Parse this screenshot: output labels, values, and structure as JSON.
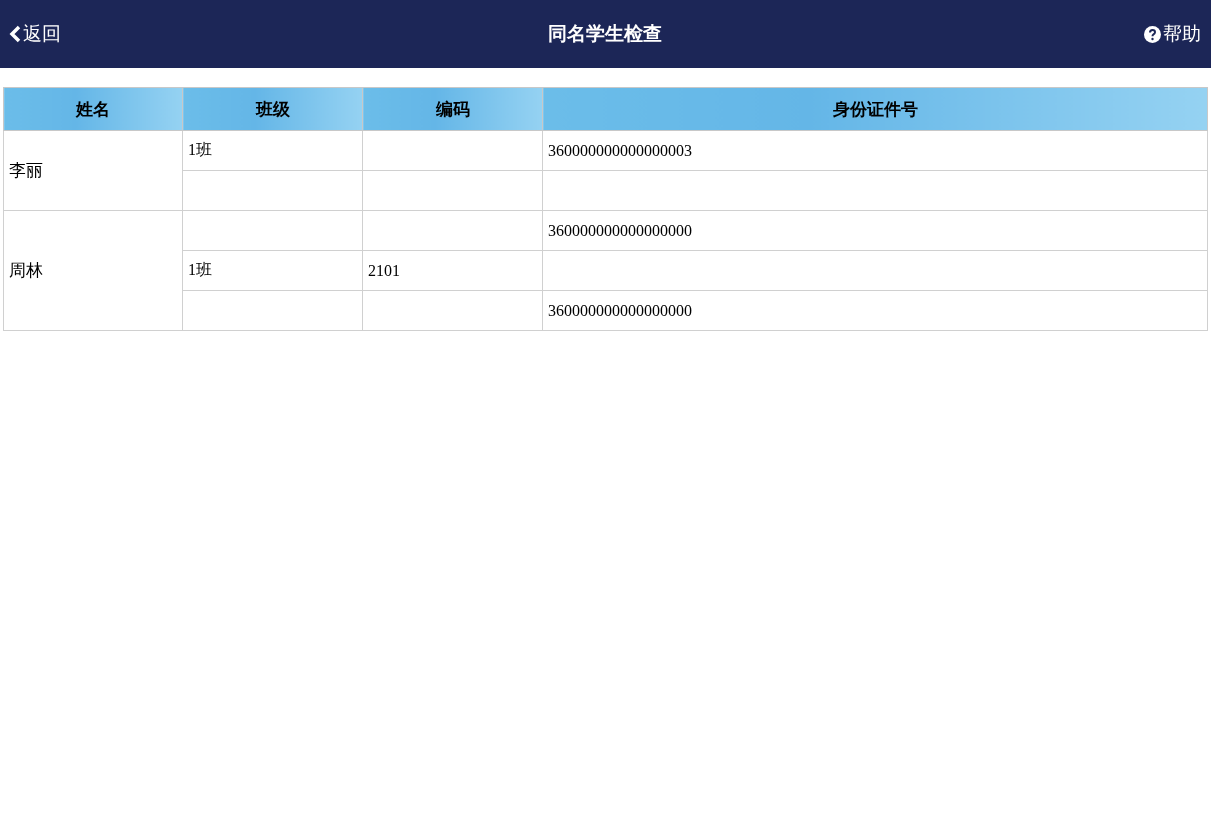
{
  "header": {
    "back": "返回",
    "title": "同名学生检查",
    "help": "帮助"
  },
  "table": {
    "columns": [
      "姓名",
      "班级",
      "编码",
      "身份证件号"
    ],
    "groups": [
      {
        "name": "李丽",
        "rows": [
          {
            "class": "1班",
            "id_number": "360000000000000003"
          },
          {}
        ]
      },
      {
        "name": "周林",
        "rows": [
          {
            "id_number": "360000000000000000"
          },
          {
            "class": "1班",
            "code": "2101"
          },
          {
            "id_number": "360000000000000000"
          }
        ]
      }
    ]
  }
}
